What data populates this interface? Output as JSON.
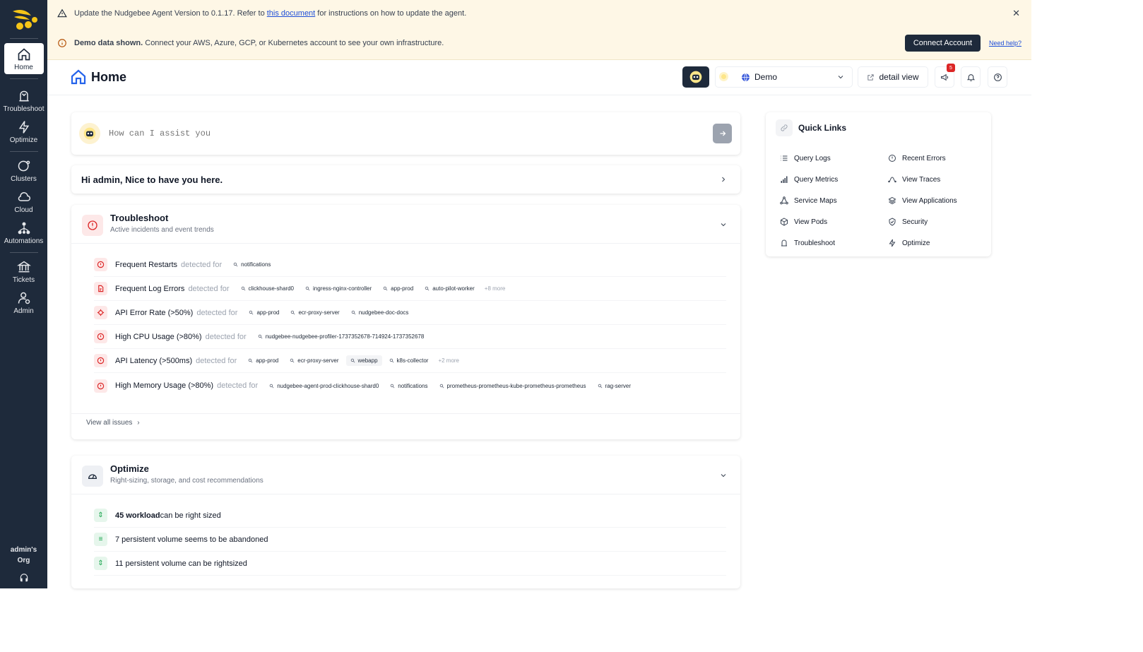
{
  "sidebar": {
    "items": [
      {
        "label": "Home"
      },
      {
        "label": "Troubleshoot"
      },
      {
        "label": "Optimize"
      },
      {
        "label": "Clusters"
      },
      {
        "label": "Cloud"
      },
      {
        "label": "Automations"
      },
      {
        "label": "Tickets"
      },
      {
        "label": "Admin"
      }
    ],
    "org_line1": "admin's",
    "org_line2": "Org"
  },
  "banner_update": {
    "text_before": "Update the Nudgebee Agent Version to 0.1.17. Refer to ",
    "link": "this document",
    "text_after": " for instructions on how to update the agent."
  },
  "banner_demo": {
    "bold": "Demo data shown.",
    "text": " Connect your AWS, Azure, GCP, or Kubernetes account to see your own infrastructure.",
    "connect_label": "Connect Account",
    "help_label": "Need help?"
  },
  "header": {
    "title": "Home",
    "workspace": "Demo",
    "detail_view": "detail view",
    "announcements_count": "5"
  },
  "assistant": {
    "placeholder": "How can I assist you"
  },
  "greeting": "Hi admin, Nice to have you here.",
  "troubleshoot": {
    "title": "Troubleshoot",
    "subtitle": "Active incidents and event trends",
    "detected_for": "detected for",
    "issues": [
      {
        "title": "Frequent Restarts",
        "tags": [
          "notifications"
        ],
        "more": ""
      },
      {
        "title": "Frequent Log Errors",
        "tags": [
          "clickhouse-shard0",
          "ingress-nginx-controller",
          "app-prod",
          "auto-pilot-worker"
        ],
        "more": "+8 more"
      },
      {
        "title": "API Error Rate (>50%)",
        "tags": [
          "app-prod",
          "ecr-proxy-server",
          "nudgebee-doc-docs"
        ],
        "more": ""
      },
      {
        "title": "High CPU Usage (>80%)",
        "tags": [
          "nudgebee-nudgebee-profiler-1737352678-714924-1737352678"
        ],
        "more": ""
      },
      {
        "title": "API Latency (>500ms)",
        "tags": [
          "app-prod",
          "ecr-proxy-server",
          "webapp",
          "k8s-collector"
        ],
        "more": "+2 more"
      },
      {
        "title": "High Memory Usage (>80%)",
        "tags": [
          "nudgebee-agent-prod-clickhouse-shard0",
          "notifications",
          "prometheus-prometheus-kube-prometheus-prometheus",
          "rag-server"
        ],
        "more": ""
      }
    ],
    "view_all": "View all issues"
  },
  "optimize": {
    "title": "Optimize",
    "subtitle": "Right-sizing, storage, and cost recommendations",
    "items": [
      {
        "bold": "45 workload",
        "text": " can be right sized"
      },
      {
        "bold": "",
        "text": "7 persistent volume seems to be abandoned"
      },
      {
        "bold": "",
        "text": "11 persistent volume can be rightsized"
      }
    ]
  },
  "quick_links": {
    "title": "Quick Links",
    "items": [
      {
        "label": "Query Logs",
        "icon": "list-icon"
      },
      {
        "label": "Recent Errors",
        "icon": "alert-circle-icon"
      },
      {
        "label": "Query Metrics",
        "icon": "bar-chart-icon"
      },
      {
        "label": "View Traces",
        "icon": "trace-icon"
      },
      {
        "label": "Service Maps",
        "icon": "network-icon"
      },
      {
        "label": "View Applications",
        "icon": "layers-icon"
      },
      {
        "label": "View Pods",
        "icon": "cube-icon"
      },
      {
        "label": "Security",
        "icon": "shield-icon"
      },
      {
        "label": "Troubleshoot",
        "icon": "troubleshoot-icon"
      },
      {
        "label": "Optimize",
        "icon": "bolt-icon"
      }
    ]
  },
  "colors": {
    "sidebar_bg": "#1e2a3b",
    "banner_bg": "#fef7e6",
    "danger": "#dc2626",
    "success": "#16a34a"
  }
}
